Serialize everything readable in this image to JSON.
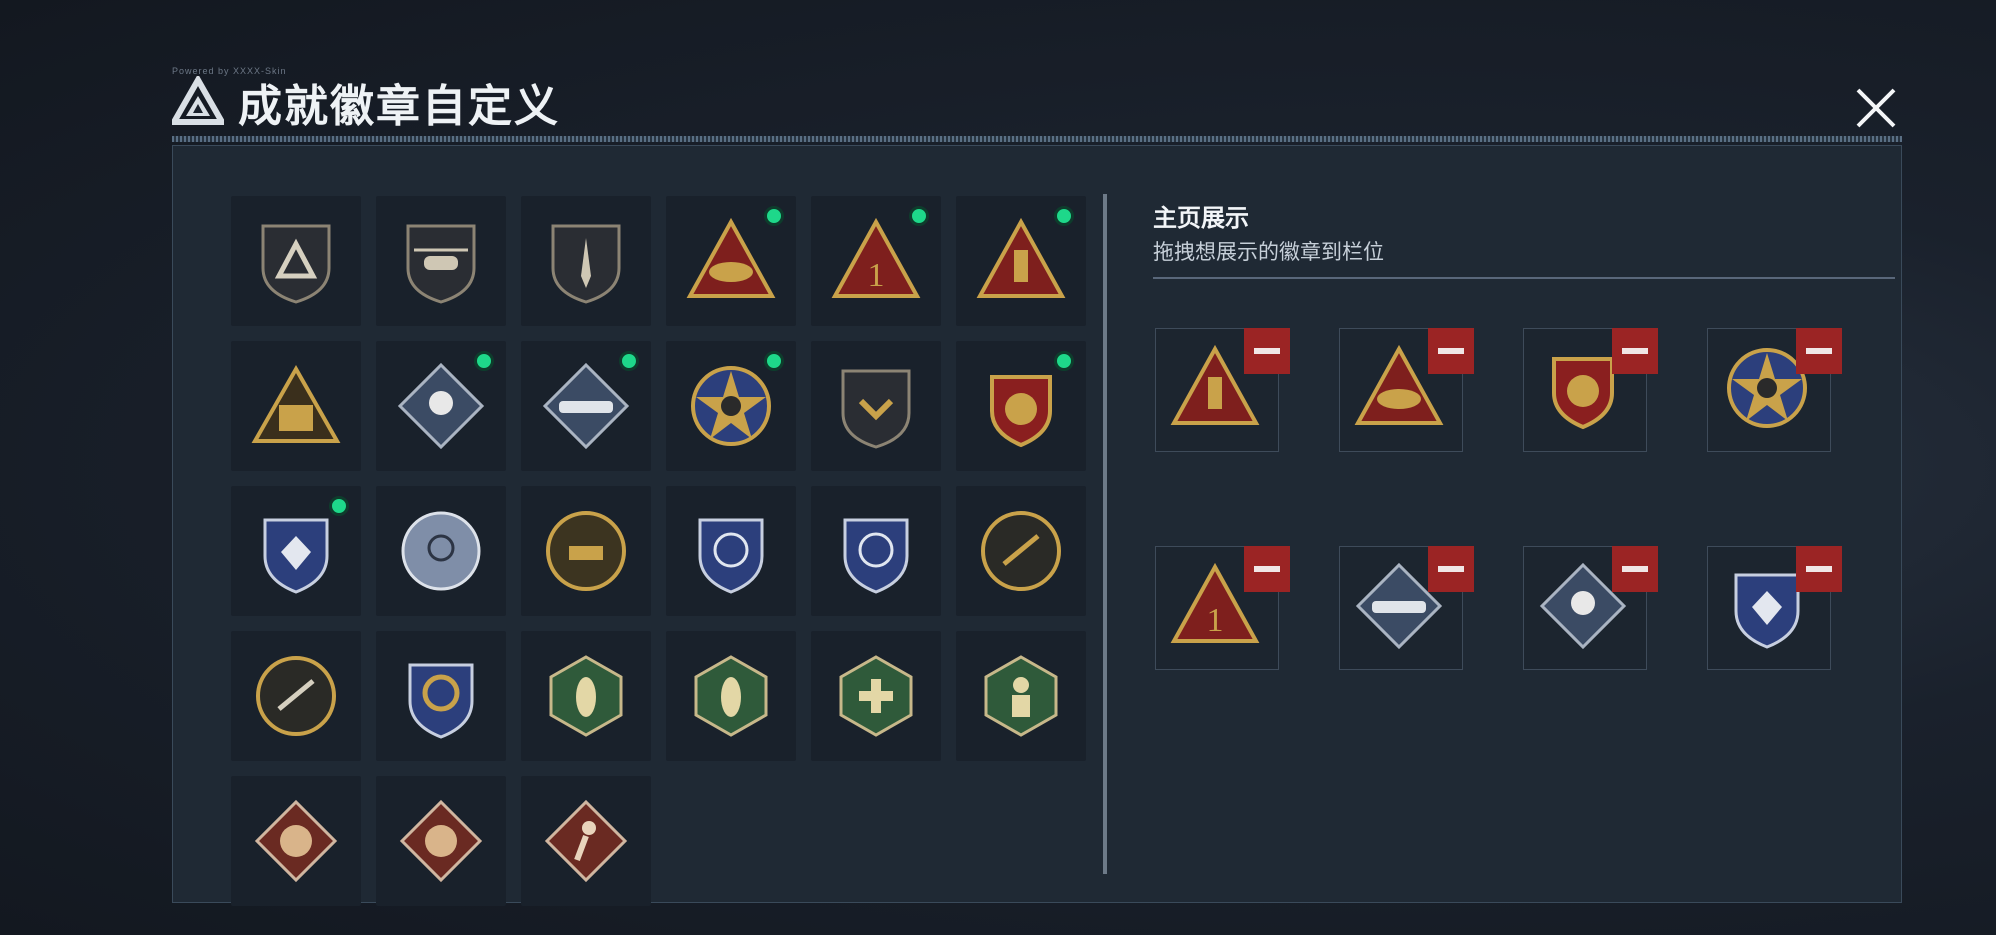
{
  "header": {
    "title": "成就徽章自定义",
    "deco_text": "Powered by XXXX-Skin"
  },
  "display": {
    "title": "主页展示",
    "subtitle": "拖拽想展示的徽章到栏位"
  },
  "colors": {
    "new_dot": "#1ed88a",
    "remove": "#9b2424",
    "gold": "#c9a24a",
    "red": "#7e1f1d",
    "blue": "#2c3f7c",
    "green": "#2f5a3a"
  },
  "badges": [
    {
      "icon": "triangle-logo-badge-icon",
      "new": false
    },
    {
      "icon": "helicopter-badge-icon",
      "new": false
    },
    {
      "icon": "dagger-shield-badge-icon",
      "new": false
    },
    {
      "icon": "eggs-nest-badge-icon",
      "new": true
    },
    {
      "icon": "number-one-badge-icon",
      "new": true
    },
    {
      "icon": "usb-drive-badge-icon",
      "new": true
    },
    {
      "icon": "squad-silhouette-badge-icon",
      "new": false
    },
    {
      "icon": "rose-badge-icon",
      "new": true
    },
    {
      "icon": "rocket-launcher-badge-icon",
      "new": true
    },
    {
      "icon": "star-skull-badge-icon",
      "new": true
    },
    {
      "icon": "chevron-shield-badge-icon",
      "new": false
    },
    {
      "icon": "winged-shield-badge-icon",
      "new": true
    },
    {
      "icon": "diamond-shield-badge-icon",
      "new": true
    },
    {
      "icon": "crosshair-cloud-badge-icon",
      "new": false
    },
    {
      "icon": "tank-sunburst-badge-icon",
      "new": false
    },
    {
      "icon": "rifle-crosshair-shield-badge-icon",
      "new": false
    },
    {
      "icon": "rifle-crosshair-shield-2-badge-icon",
      "new": false
    },
    {
      "icon": "rifle-circle-badge-icon",
      "new": false
    },
    {
      "icon": "sniper-circle-badge-icon",
      "new": false
    },
    {
      "icon": "gold-crosshair-crest-badge-icon",
      "new": false
    },
    {
      "icon": "hornet-badge-icon",
      "new": false
    },
    {
      "icon": "hornet-2-badge-icon",
      "new": false
    },
    {
      "icon": "medic-cross-badge-icon",
      "new": false
    },
    {
      "icon": "soldier-hex-badge-icon",
      "new": false
    },
    {
      "icon": "dragon-badge-icon",
      "new": false
    },
    {
      "icon": "dragon-2-badge-icon",
      "new": false
    },
    {
      "icon": "runner-badge-icon",
      "new": false
    }
  ],
  "showcase": [
    {
      "icon": "usb-drive-badge-icon"
    },
    {
      "icon": "eggs-nest-badge-icon"
    },
    {
      "icon": "winged-shield-badge-icon"
    },
    {
      "icon": "star-skull-badge-icon"
    },
    {
      "icon": "number-one-badge-icon"
    },
    {
      "icon": "rocket-launcher-badge-icon"
    },
    {
      "icon": "rose-badge-icon"
    },
    {
      "icon": "diamond-shield-badge-icon"
    }
  ]
}
